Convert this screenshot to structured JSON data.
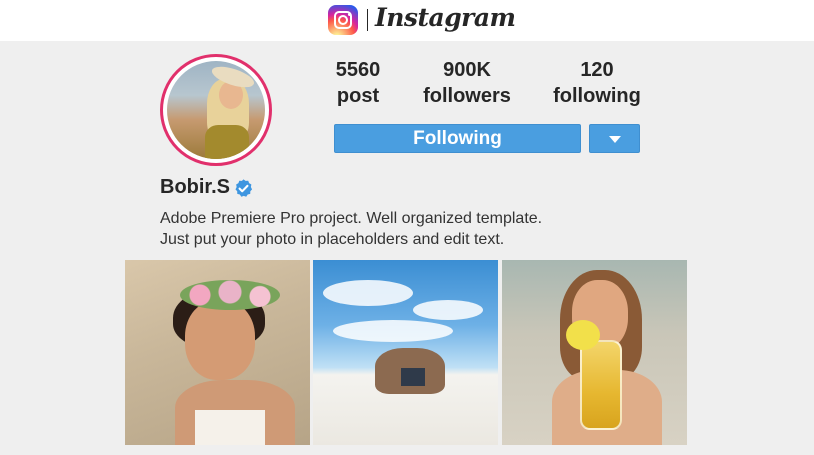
{
  "brand": {
    "wordmark": "Instagram",
    "accent_gradient": [
      "#fdf497",
      "#fd5949",
      "#d6249f",
      "#285AEB"
    ]
  },
  "profile": {
    "username": "Bobir.S",
    "verified": true,
    "avatar_ring_color": "#e1306c",
    "stats": {
      "posts": {
        "value": "5560",
        "label": "post"
      },
      "followers": {
        "value": "900K",
        "label": "followers"
      },
      "following": {
        "value": "120",
        "label": "following"
      }
    },
    "follow_button_label": "Following",
    "button_color": "#4a9ee0",
    "bio_lines": [
      "Adobe Premiere Pro project. Well organized template.",
      "Just put your photo in placeholders and edit text."
    ]
  },
  "icons": {
    "logo": "instagram-logo-icon",
    "verified": "verified-badge-icon",
    "dropdown": "chevron-down-icon"
  },
  "posts": [
    {
      "name": "flower-crown-portrait"
    },
    {
      "name": "beach-couple"
    },
    {
      "name": "woman-with-drink"
    }
  ]
}
